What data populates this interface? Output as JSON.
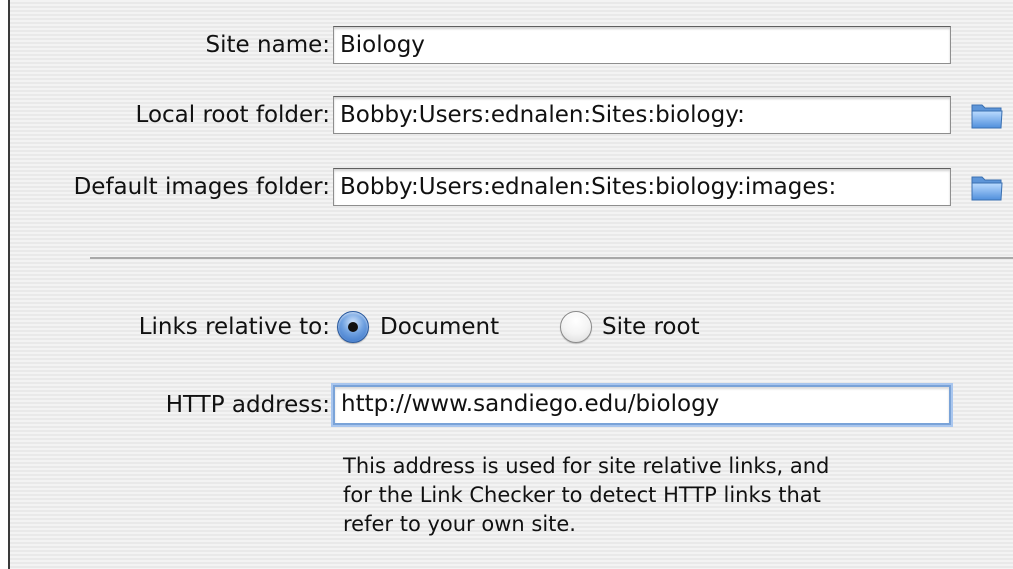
{
  "site_name": {
    "label": "Site name:",
    "value": "Biology"
  },
  "local_root_folder": {
    "label": "Local root folder:",
    "value": "Bobby:Users:ednalen:Sites:biology:",
    "browse_icon": "folder-icon"
  },
  "default_images_folder": {
    "label": "Default images folder:",
    "value": "Bobby:Users:ednalen:Sites:biology:images:",
    "browse_icon": "folder-icon"
  },
  "links_relative_to": {
    "label": "Links relative to:",
    "options": [
      {
        "label": "Document",
        "selected": true
      },
      {
        "label": "Site root",
        "selected": false
      }
    ]
  },
  "http_address": {
    "label": "HTTP address:",
    "value": "http://www.sandiego.edu/biology"
  },
  "help_text": [
    "This address is used for site relative links, and",
    "for the Link Checker to detect HTTP links that",
    "refer to your own site."
  ],
  "colors": {
    "focus_ring": "#7aa3d8",
    "radio_selected": "#2f6bc2",
    "folder_icon": "#6fa6e6"
  }
}
